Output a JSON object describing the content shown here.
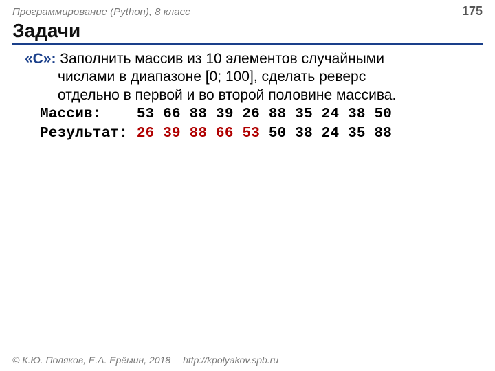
{
  "header": {
    "course": "Программирование (Python), 8 класс",
    "page": "175"
  },
  "title": "Задачи",
  "task": {
    "label": "«C»:",
    "line1": " Заполнить массив из 10 элементов случайными",
    "line2": "числами в диапазоне [0; 100], сделать реверс",
    "line3": "отдельно в первой и во второй половине массива."
  },
  "array_row": {
    "label": "Массив:    ",
    "values": "53 66 88 39 26 88 35 24 38 50"
  },
  "result_row": {
    "label": "Результат: ",
    "red_part": "26 39 88 66 53",
    "rest": " 50 38 24 35 88"
  },
  "footer": {
    "copy": "© К.Ю. Поляков, Е.А. Ерёмин, 2018",
    "url": "http://kpolyakov.spb.ru"
  }
}
